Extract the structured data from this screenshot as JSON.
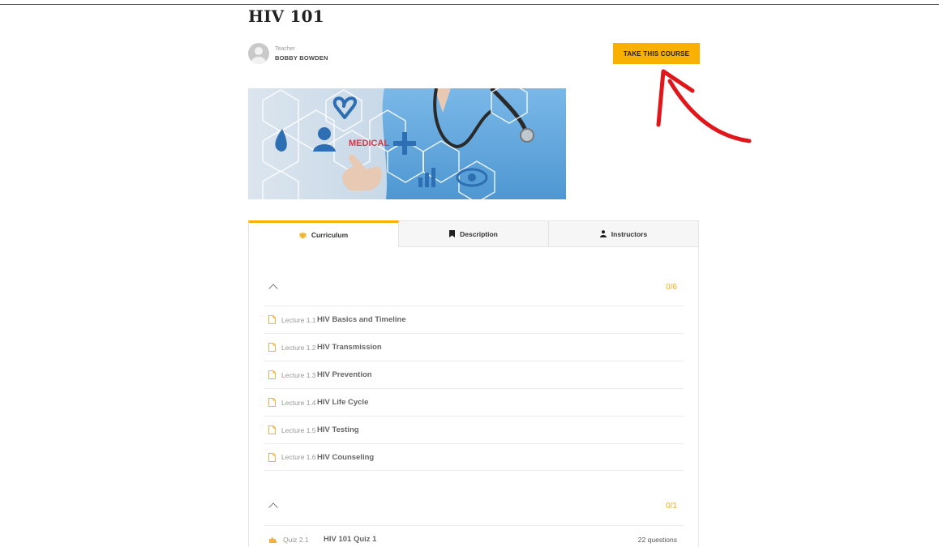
{
  "course": {
    "title": "HIV 101",
    "teacher_role": "Teacher",
    "teacher_name": "BOBBY BOWDEN",
    "take_button": "TAKE THIS COURSE",
    "hero_text": "MEDICAL"
  },
  "tabs": [
    {
      "label": "Curriculum",
      "icon": "cube-icon"
    },
    {
      "label": "Description",
      "icon": "bookmark-icon"
    },
    {
      "label": "Instructors",
      "icon": "user-icon"
    }
  ],
  "sections": [
    {
      "progress": "0/6",
      "items": [
        {
          "kind": "Lecture 1.1",
          "title": "HIV Basics and Timeline"
        },
        {
          "kind": "Lecture 1.2",
          "title": "HIV Transmission"
        },
        {
          "kind": "Lecture 1.3",
          "title": "HIV Prevention"
        },
        {
          "kind": "Lecture 1.4",
          "title": "HIV Life Cycle"
        },
        {
          "kind": "Lecture 1.5",
          "title": "HIV Testing"
        },
        {
          "kind": "Lecture 1.6",
          "title": "HIV Counseling"
        }
      ]
    },
    {
      "progress": "0/1",
      "items": [
        {
          "kind": "Quiz 2.1",
          "title": "HIV 101 Quiz 1",
          "meta": "22 questions"
        }
      ]
    }
  ],
  "colors": {
    "accent": "#f9b000",
    "progress": "#f0ad1f",
    "arrow": "#e0161a"
  }
}
